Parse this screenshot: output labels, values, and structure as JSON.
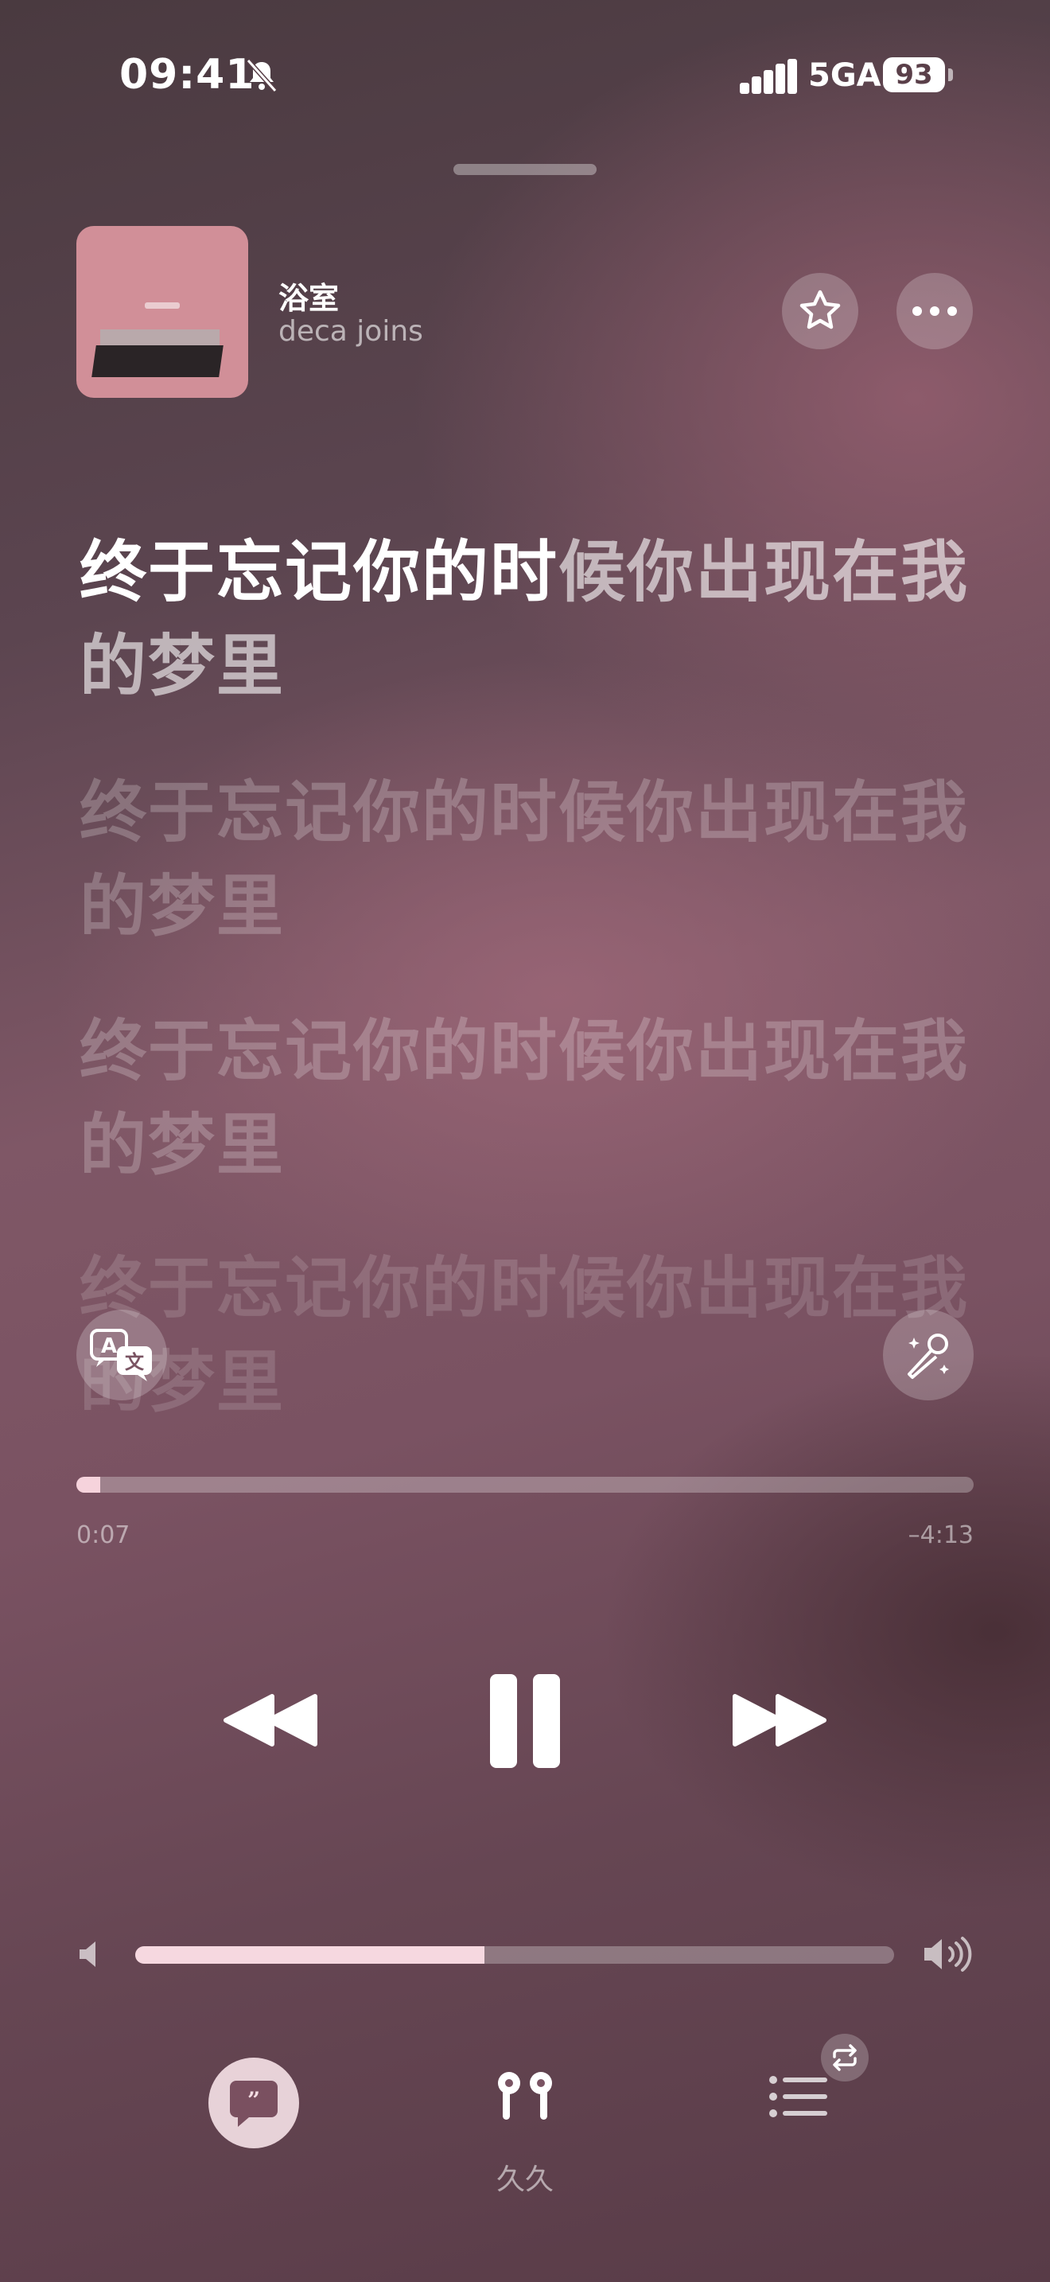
{
  "status_bar": {
    "time": "09:41",
    "network": "5GA",
    "battery": "93"
  },
  "now_playing": {
    "title": "浴室",
    "artist": "deca joins"
  },
  "lyrics": {
    "current": {
      "sung": "终于忘记你的时",
      "unsung": "候你出现在我的梦里"
    },
    "upcoming": [
      "终于忘记你的时候你出现在我的梦里",
      "终于忘记你的时候你出现在我的梦里",
      "终于忘记你的时候你出现在我的梦里"
    ]
  },
  "playback": {
    "elapsed": "0:07",
    "remaining": "–4:13",
    "progress_fraction": 0.027,
    "volume_fraction": 0.46
  },
  "output_device": {
    "name": "久久"
  },
  "icons": {
    "bell": "bell-slash-icon",
    "star": "star-icon",
    "more": "ellipsis-icon",
    "translate": "translate-icon",
    "mic": "microphone-sparkle-icon",
    "rewind": "backward-icon",
    "pause": "pause-icon",
    "forward": "forward-icon",
    "speaker_low": "speaker-low-icon",
    "speaker_high": "speaker-high-icon",
    "lyrics": "quote-bubble-icon",
    "airpods": "airpods-icon",
    "queue": "list-icon",
    "repeat": "repeat-icon"
  },
  "colors": {
    "accent_fill": "#ffdce4"
  }
}
